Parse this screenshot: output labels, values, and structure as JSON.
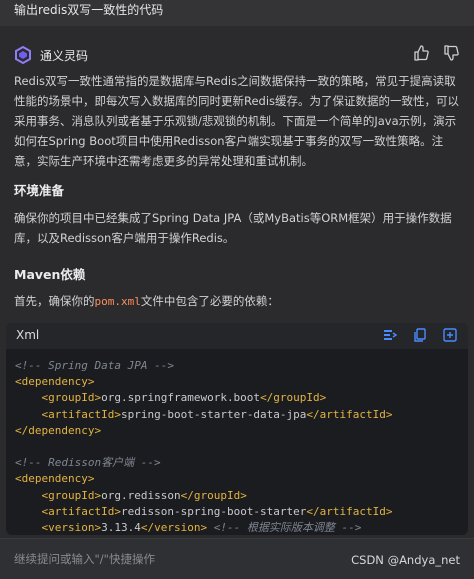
{
  "prompt": {
    "text": "输出redis双写一致性的代码"
  },
  "header": {
    "brand": "通义灵码"
  },
  "intro": "Redis双写一致性通常指的是数据库与Redis之间数据保持一致的策略，常见于提高读取性能的场景中，即每次写入数据库的同时更新Redis缓存。为了保证数据的一致性，可以采用事务、消息队列或者基于乐观锁/悲观锁的机制。下面是一个简单的Java示例，演示如何在Spring Boot项目中使用Redisson客户端实现基于事务的双写一致性策略。注意，实际生产环境中还需考虑更多的异常处理和重试机制。",
  "section1": {
    "title": "环境准备",
    "text": "确保你的项目中已经集成了Spring Data JPA（或MyBatis等ORM框架）用于操作数据库，以及Redisson客户端用于操作Redis。"
  },
  "section2": {
    "title": "Maven依赖",
    "text_before": "首先，确保你的",
    "file": "pom.xml",
    "text_after": "文件中包含了必要的依赖："
  },
  "code": {
    "lang": "Xml",
    "lines": [
      {
        "kind": "comment",
        "text": "<!-- Spring Data JPA -->"
      },
      {
        "kind": "tag",
        "text": "<dependency>"
      },
      {
        "kind": "pair",
        "indent": "    ",
        "open": "<groupId>",
        "value": "org.springframework.boot",
        "close": "</groupId>"
      },
      {
        "kind": "pair",
        "indent": "    ",
        "open": "<artifactId>",
        "value": "spring-boot-starter-data-jpa",
        "close": "</artifactId>"
      },
      {
        "kind": "tag",
        "text": "</dependency>"
      },
      {
        "kind": "blank",
        "text": ""
      },
      {
        "kind": "comment",
        "text": "<!-- Redisson客户端 -->"
      },
      {
        "kind": "tag",
        "text": "<dependency>"
      },
      {
        "kind": "pair",
        "indent": "    ",
        "open": "<groupId>",
        "value": "org.redisson",
        "close": "</groupId>"
      },
      {
        "kind": "pair",
        "indent": "    ",
        "open": "<artifactId>",
        "value": "redisson-spring-boot-starter",
        "close": "</artifactId>"
      },
      {
        "kind": "pairc",
        "indent": "    ",
        "open": "<version>",
        "value": "3.13.4",
        "close": "</version>",
        "comment": " <!-- 根据实际版本调整 -->"
      }
    ]
  },
  "input": {
    "placeholder": "继续提问或输入\"/\"快捷操作"
  },
  "watermark": "CSDN @Andya_net"
}
